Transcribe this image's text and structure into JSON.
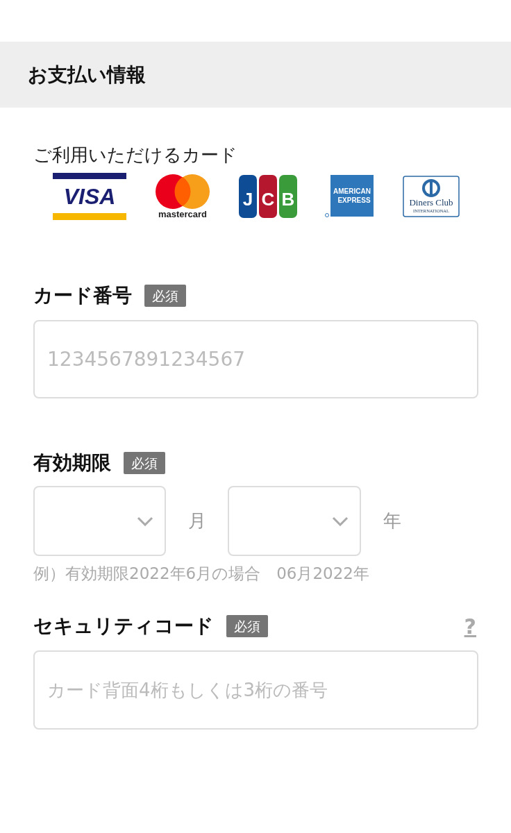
{
  "header": {
    "title": "お支払い情報"
  },
  "cards": {
    "label": "ご利用いただけるカード",
    "brands": [
      {
        "kind": "visa",
        "lines": [
          "VISA"
        ]
      },
      {
        "kind": "mastercard",
        "lines": [
          "mastercard"
        ]
      },
      {
        "kind": "jcb",
        "lines": [
          "J",
          "C",
          "B"
        ]
      },
      {
        "kind": "amex",
        "lines": [
          "AMERICAN",
          "EXPRESS"
        ]
      },
      {
        "kind": "diners",
        "lines": [
          "Diners Club",
          "INTERNATIONAL"
        ]
      }
    ]
  },
  "card_number": {
    "label": "カード番号",
    "badge": "必須",
    "placeholder": "1234567891234567"
  },
  "expiry": {
    "label": "有効期限",
    "badge": "必須",
    "month_unit": "月",
    "year_unit": "年",
    "example": "例）有効期限2022年6月の場合　06月2022年"
  },
  "security_code": {
    "label": "セキュリティコード",
    "badge": "必須",
    "help": "?",
    "placeholder": "カード背面4桁もしくは3桁の番号"
  }
}
